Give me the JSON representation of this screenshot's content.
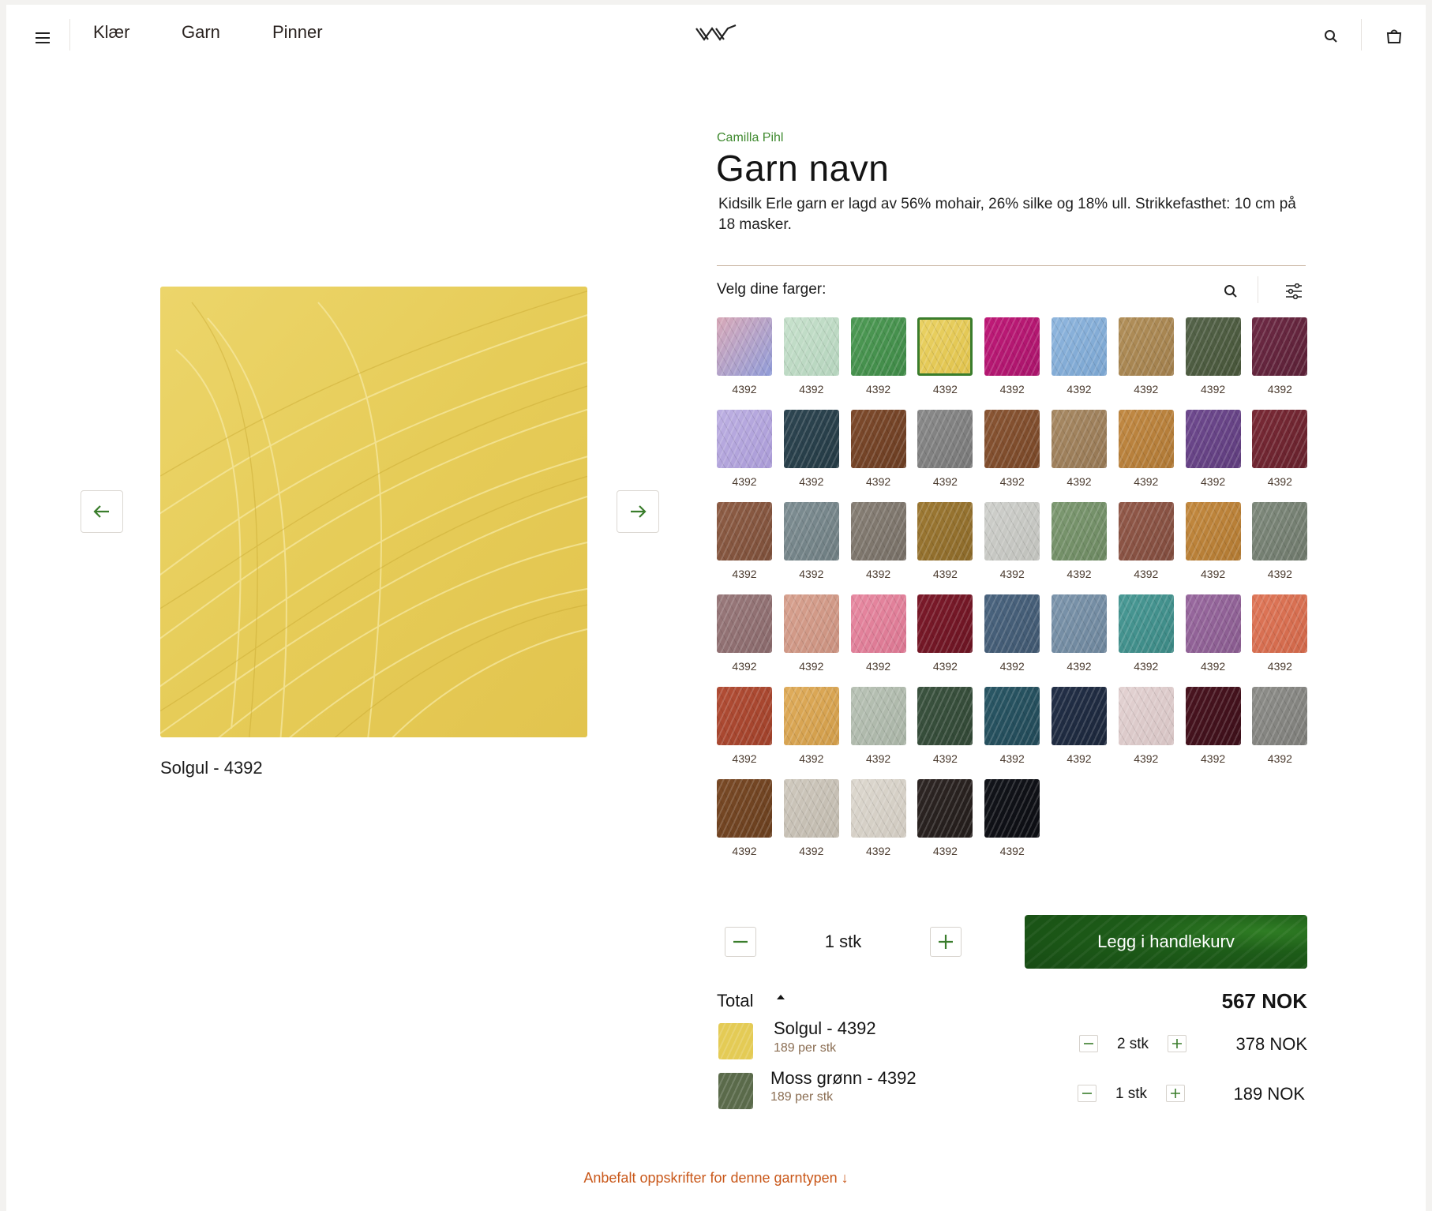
{
  "header": {
    "nav": [
      "Klær",
      "Garn",
      "Pinner"
    ],
    "icons": [
      "menu-icon",
      "logo-icon",
      "search-icon",
      "shopping-bag-icon"
    ]
  },
  "gallery": {
    "caption": "Solgul - 4392",
    "image_color": "#e8cf5a",
    "prev_icon": "arrow-left-icon",
    "next_icon": "arrow-right-icon"
  },
  "product": {
    "brand": "Camilla Pihl",
    "title": "Garn navn",
    "description": "Kidsilk Erle garn er lagd av 56% mohair, 26% silke og 18% ull. Strikkefasthet: 10 cm på 18 masker.",
    "pick_label": "Velg dine farger:"
  },
  "swatches": [
    {
      "num": "4392",
      "color": "#d9a9b8",
      "color2": "#8f9bd8"
    },
    {
      "num": "4392",
      "color": "#c7e1cc",
      "color2": "#b4d3bc"
    },
    {
      "num": "4392",
      "color": "#4f9b56",
      "color2": "#3e8846"
    },
    {
      "num": "4392",
      "color": "#ead264",
      "color2": "#e0c24c",
      "selected": true
    },
    {
      "num": "4392",
      "color": "#c01a78",
      "color2": "#a8146a"
    },
    {
      "num": "4392",
      "color": "#8fb6de",
      "color2": "#7aa4cf"
    },
    {
      "num": "4392",
      "color": "#b2905a",
      "color2": "#9f7d4b"
    },
    {
      "num": "4392",
      "color": "#55644a",
      "color2": "#465438"
    },
    {
      "num": "4392",
      "color": "#6e2a45",
      "color2": "#5a2036"
    },
    {
      "num": "4392",
      "color": "#bdb0e2",
      "color2": "#a99ad6"
    },
    {
      "num": "4392",
      "color": "#2e4652",
      "color2": "#243a44"
    },
    {
      "num": "4392",
      "color": "#7e4b2c",
      "color2": "#6a3c22"
    },
    {
      "num": "4392",
      "color": "#8a8a8a",
      "color2": "#767676"
    },
    {
      "num": "4392",
      "color": "#8a5634",
      "color2": "#774627"
    },
    {
      "num": "4392",
      "color": "#a88a64",
      "color2": "#947653"
    },
    {
      "num": "4392",
      "color": "#c28a44",
      "color2": "#ae7734"
    },
    {
      "num": "4392",
      "color": "#6f4a8f",
      "color2": "#5e3c7c"
    },
    {
      "num": "4392",
      "color": "#7a2a36",
      "color2": "#66212c"
    },
    {
      "num": "4392",
      "color": "#8f5e46",
      "color2": "#7b4e39"
    },
    {
      "num": "4392",
      "color": "#7f8f94",
      "color2": "#6d7c80"
    },
    {
      "num": "4392",
      "color": "#888076",
      "color2": "#756d64"
    },
    {
      "num": "4392",
      "color": "#9e7a34",
      "color2": "#8a6828"
    },
    {
      "num": "4392",
      "color": "#cfd0cc",
      "color2": "#bfc0bb"
    },
    {
      "num": "4392",
      "color": "#7e9a72",
      "color2": "#6b8760"
    },
    {
      "num": "4392",
      "color": "#935a4a",
      "color2": "#7f4b3d"
    },
    {
      "num": "4392",
      "color": "#c48a40",
      "color2": "#b07831"
    },
    {
      "num": "4392",
      "color": "#7f8a7c",
      "color2": "#6d776a"
    },
    {
      "num": "4392",
      "color": "#9a7a7c",
      "color2": "#876769"
    },
    {
      "num": "4392",
      "color": "#d8a290",
      "color2": "#c9907e"
    },
    {
      "num": "4392",
      "color": "#e88aa2",
      "color2": "#d97590"
    },
    {
      "num": "4392",
      "color": "#7d1a2a",
      "color2": "#6a1422"
    },
    {
      "num": "4392",
      "color": "#4b6580",
      "color2": "#3f566e"
    },
    {
      "num": "4392",
      "color": "#7d96ad",
      "color2": "#6c849a"
    },
    {
      "num": "4392",
      "color": "#4a9a96",
      "color2": "#3b8783"
    },
    {
      "num": "4392",
      "color": "#9a6aa0",
      "color2": "#875a8d"
    },
    {
      "num": "4392",
      "color": "#e0785a",
      "color2": "#cf6648"
    },
    {
      "num": "4392",
      "color": "#b34e36",
      "color2": "#9e4029"
    },
    {
      "num": "4392",
      "color": "#e0ad5c",
      "color2": "#cf9b48"
    },
    {
      "num": "4392",
      "color": "#b9c3b6",
      "color2": "#a7b2a4"
    },
    {
      "num": "4392",
      "color": "#3c5440",
      "color2": "#304634"
    },
    {
      "num": "4392",
      "color": "#2a5866",
      "color2": "#214856"
    },
    {
      "num": "4392",
      "color": "#233048",
      "color2": "#1b263a"
    },
    {
      "num": "4392",
      "color": "#e3d2d2",
      "color2": "#d6c3c3"
    },
    {
      "num": "4392",
      "color": "#4a1420",
      "color2": "#3c0f19"
    },
    {
      "num": "4392",
      "color": "#8e8e8a",
      "color2": "#7c7c78"
    },
    {
      "num": "4392",
      "color": "#7a4a26",
      "color2": "#683e1e"
    },
    {
      "num": "4392",
      "color": "#cfc9be",
      "color2": "#bfb8ac"
    },
    {
      "num": "4392",
      "color": "#ddd8cf",
      "color2": "#cfc9bf"
    },
    {
      "num": "4392",
      "color": "#2e2624",
      "color2": "#221c1a"
    },
    {
      "num": "4392",
      "color": "#12141a",
      "color2": "#0c0d12"
    }
  ],
  "quantity": {
    "value": "1 stk",
    "add_label": "Legg i handlekurv"
  },
  "cart": {
    "total_label": "Total",
    "total": "567 NOK",
    "lines": [
      {
        "name": "Solgul - 4392",
        "unit": "189 per stk",
        "qty": "2 stk",
        "price": "378 NOK",
        "color": "#e4cb55"
      },
      {
        "name": "Moss grønn - 4392",
        "unit": "189 per stk",
        "qty": "1 stk",
        "price": "189 NOK",
        "color": "#5a6a4a"
      }
    ]
  },
  "recommend": "Anbefalt oppskrifter for denne garntypen ↓",
  "colors": {
    "accent": "#3a7d2c",
    "brand_text": "#3f8a2f",
    "cta": "#1d5c18",
    "link": "#c9581a"
  }
}
